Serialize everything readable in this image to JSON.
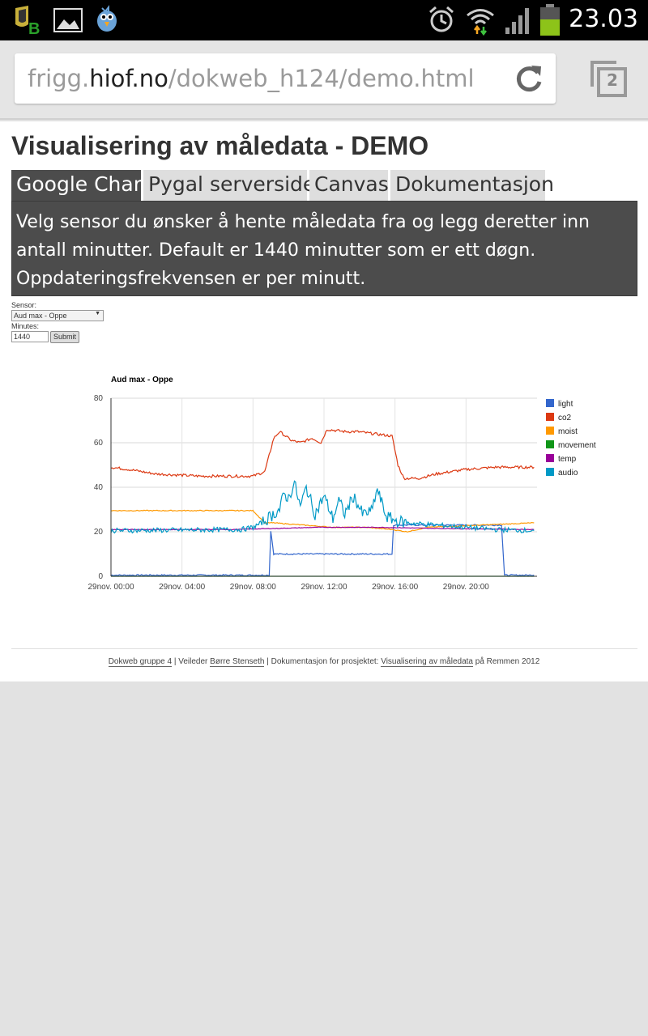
{
  "status_bar": {
    "time": "23.03",
    "icons": [
      "app-badge-icon",
      "image-icon",
      "bird-app-icon",
      "alarm-icon",
      "wifi-icon",
      "signal-icon",
      "battery-icon"
    ]
  },
  "browser": {
    "url_prefix": "frigg.",
    "url_host": "hiof.no",
    "url_path": "/dokweb_h124/demo.html",
    "tab_count": "2"
  },
  "page": {
    "title": "Visualisering av måledata - DEMO",
    "tabs": [
      "Google Chart",
      "Pygal serverside",
      "Canvas",
      "Dokumentasjon"
    ],
    "active_tab": "Google Chart",
    "description_lines": [
      "Velg sensor du ønsker å hente måledata fra og legg deretter inn",
      "antall minutter. Default er 1440 minutter som er ett døgn.",
      "Oppdateringsfrekvensen er per minutt."
    ],
    "form": {
      "sensor_label": "Sensor:",
      "sensor_value": "Aud max - Oppe",
      "minutes_label": "Minutes:",
      "minutes_value": "1440",
      "submit_label": "Submit"
    },
    "footer": {
      "link1": "Dokweb gruppe 4",
      "sep1": " | Veileder ",
      "link2": "Børre Stenseth",
      "sep2": " | Dokumentasjon for prosjektet: ",
      "link3": "Visualisering av måledata",
      "tail": " på Remmen 2012"
    }
  },
  "colors": {
    "light": "#3366cc",
    "co2": "#dc3912",
    "moist": "#ff9900",
    "movement": "#109618",
    "temp": "#990099",
    "audio": "#0099c6"
  },
  "chart_data": {
    "type": "line",
    "title": "Aud max - Oppe",
    "xlabel": "",
    "ylabel": "",
    "ylim": [
      0,
      80
    ],
    "yticks": [
      0,
      20,
      40,
      60,
      80
    ],
    "xlim": [
      0,
      1440
    ],
    "xticks": [
      {
        "t": 0,
        "label": "29nov. 00:00"
      },
      {
        "t": 240,
        "label": "29nov. 04:00"
      },
      {
        "t": 480,
        "label": "29nov. 08:00"
      },
      {
        "t": 720,
        "label": "29nov. 12:00"
      },
      {
        "t": 960,
        "label": "29nov. 16:00"
      },
      {
        "t": 1200,
        "label": "29nov. 20:00"
      }
    ],
    "grid": true,
    "legend_position": "right",
    "series": [
      {
        "name": "light",
        "points": [
          [
            0,
            0.5
          ],
          [
            535,
            0.5
          ],
          [
            540,
            20.5
          ],
          [
            550,
            10
          ],
          [
            950,
            10
          ],
          [
            955,
            23
          ],
          [
            1320,
            23
          ],
          [
            1330,
            0.5
          ],
          [
            1430,
            0.5
          ]
        ]
      },
      {
        "name": "co2",
        "points": [
          [
            0,
            49
          ],
          [
            60,
            48
          ],
          [
            150,
            46
          ],
          [
            300,
            45
          ],
          [
            480,
            45
          ],
          [
            520,
            47
          ],
          [
            550,
            62
          ],
          [
            570,
            65
          ],
          [
            610,
            61
          ],
          [
            640,
            60
          ],
          [
            680,
            62
          ],
          [
            710,
            60
          ],
          [
            730,
            66
          ],
          [
            790,
            65
          ],
          [
            830,
            65
          ],
          [
            950,
            63
          ],
          [
            970,
            50
          ],
          [
            990,
            44
          ],
          [
            1040,
            44
          ],
          [
            1100,
            46
          ],
          [
            1200,
            48
          ],
          [
            1300,
            49
          ],
          [
            1430,
            49
          ]
        ]
      },
      {
        "name": "moist",
        "points": [
          [
            0,
            29.5
          ],
          [
            200,
            29.5
          ],
          [
            260,
            29.5
          ],
          [
            480,
            29.5
          ],
          [
            520,
            24
          ],
          [
            550,
            24
          ],
          [
            650,
            23
          ],
          [
            750,
            22
          ],
          [
            860,
            22
          ],
          [
            950,
            21
          ],
          [
            1000,
            20
          ],
          [
            1070,
            22
          ],
          [
            1250,
            23
          ],
          [
            1430,
            24
          ]
        ]
      },
      {
        "name": "movement",
        "points": [
          [
            0,
            0
          ],
          [
            1430,
            0
          ]
        ]
      },
      {
        "name": "temp",
        "points": [
          [
            0,
            21
          ],
          [
            400,
            21
          ],
          [
            560,
            21.5
          ],
          [
            700,
            22
          ],
          [
            900,
            22
          ],
          [
            1100,
            21.5
          ],
          [
            1430,
            21
          ]
        ]
      },
      {
        "name": "audio",
        "points": [
          [
            0,
            20.5
          ],
          [
            440,
            21
          ],
          [
            480,
            22
          ],
          [
            510,
            24
          ],
          [
            540,
            27
          ],
          [
            570,
            30
          ],
          [
            585,
            37
          ],
          [
            600,
            35
          ],
          [
            620,
            42
          ],
          [
            640,
            31
          ],
          [
            660,
            40
          ],
          [
            690,
            28
          ],
          [
            720,
            36
          ],
          [
            750,
            26
          ],
          [
            770,
            34
          ],
          [
            790,
            28
          ],
          [
            820,
            36
          ],
          [
            850,
            28
          ],
          [
            880,
            29
          ],
          [
            900,
            39
          ],
          [
            930,
            27
          ],
          [
            960,
            25
          ],
          [
            1000,
            24
          ],
          [
            1100,
            23
          ],
          [
            1200,
            22
          ],
          [
            1300,
            21
          ],
          [
            1430,
            20.5
          ]
        ]
      }
    ]
  }
}
